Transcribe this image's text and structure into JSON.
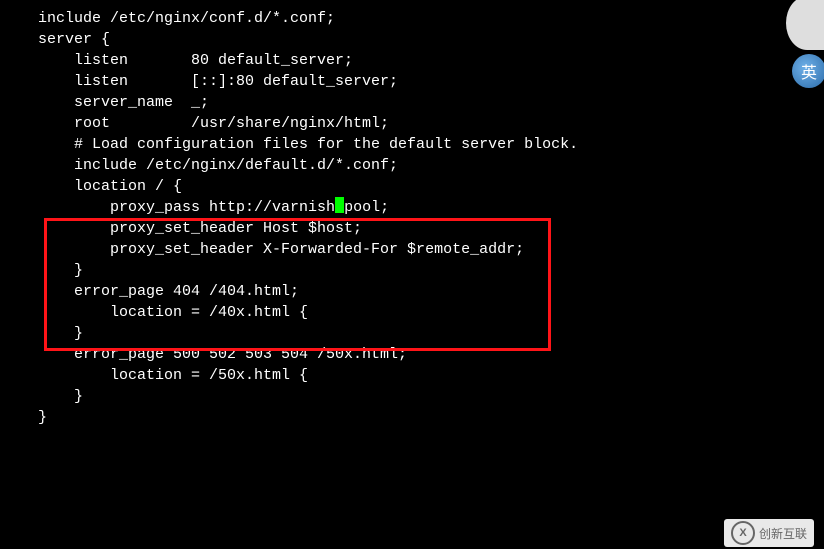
{
  "lines": {
    "l0": "include /etc/nginx/conf.d/*.conf;",
    "l1": "",
    "l2": "server {",
    "l3": "    listen       80 default_server;",
    "l4": "    listen       [::]:80 default_server;",
    "l5": "    server_name  _;",
    "l6": "    root         /usr/share/nginx/html;",
    "l7": "",
    "l8": "    # Load configuration files for the default server block.",
    "l9": "    include /etc/nginx/default.d/*.conf;",
    "l10": "",
    "l11": "    location / {",
    "l12a": "        proxy_pass http://varnish",
    "l12b": "pool;",
    "l13": "        proxy_set_header Host $host;",
    "l14": "        proxy_set_header X-Forwarded-For $remote_addr;",
    "l15": "    }",
    "l16": "",
    "l17": "    error_page 404 /404.html;",
    "l18": "        location = /40x.html {",
    "l19": "    }",
    "l20": "",
    "l21": "    error_page 500 502 503 504 /50x.html;",
    "l22": "        location = /50x.html {",
    "l23": "    }",
    "l24": "}"
  },
  "watermark": {
    "logo_letter": "X",
    "text": "创新互联"
  },
  "decor": {
    "glyph": "英"
  }
}
